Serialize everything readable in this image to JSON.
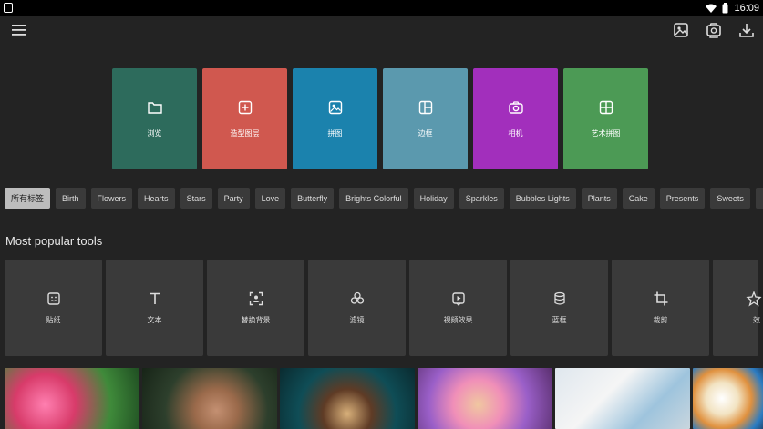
{
  "status_bar": {
    "time": "16:09",
    "icons": [
      "notification-icon",
      "wifi-icon",
      "battery-icon"
    ]
  },
  "app_bar": {
    "menu_icon": "hamburger-menu-icon",
    "actions": [
      "gallery-icon",
      "saved-icon",
      "download-icon"
    ]
  },
  "feature_cards": [
    {
      "label": "浏览",
      "icon": "folder-icon",
      "color": "#2d6b5c"
    },
    {
      "label": "造型图层",
      "icon": "add-layer-icon",
      "color": "#d0584f"
    },
    {
      "label": "拼图",
      "icon": "image-icon",
      "color": "#1b82ad"
    },
    {
      "label": "边框",
      "icon": "frame-icon",
      "color": "#5b99ae"
    },
    {
      "label": "相机",
      "icon": "camera-icon",
      "color": "#a22fbc"
    },
    {
      "label": "艺术拼图",
      "icon": "grid-icon",
      "color": "#4c9a55"
    }
  ],
  "categories": {
    "selected_index": 0,
    "items": [
      "所有标签",
      "Birth",
      "Flowers",
      "Hearts",
      "Stars",
      "Party",
      "Love",
      "Butterfly",
      "Brights Colorful",
      "Holiday",
      "Sparkles",
      "Bubbles Lights",
      "Plants",
      "Cake",
      "Presents",
      "Sweets",
      ""
    ]
  },
  "popular": {
    "title": "Most popular tools",
    "tools": [
      {
        "label": "贴纸",
        "icon": "sticker-icon"
      },
      {
        "label": "文本",
        "icon": "text-icon"
      },
      {
        "label": "替换背景",
        "icon": "replace-background-icon"
      },
      {
        "label": "滤镜",
        "icon": "filter-icon"
      },
      {
        "label": "视频效果",
        "icon": "video-effect-icon"
      },
      {
        "label": "蓝框",
        "icon": "layers-icon"
      },
      {
        "label": "裁剪",
        "icon": "crop-icon"
      },
      {
        "label": "效",
        "icon": "star-icon"
      }
    ]
  }
}
